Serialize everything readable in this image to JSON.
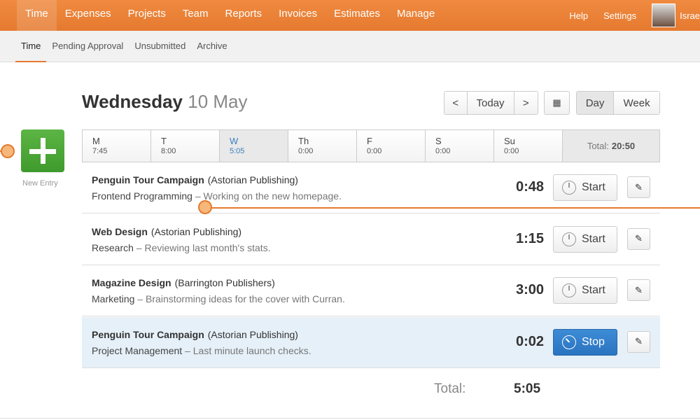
{
  "nav": {
    "items": [
      "Time",
      "Expenses",
      "Projects",
      "Team",
      "Reports",
      "Invoices",
      "Estimates",
      "Manage"
    ],
    "help": "Help",
    "settings": "Settings",
    "user": "Israe"
  },
  "subnav": [
    "Time",
    "Pending Approval",
    "Unsubmitted",
    "Archive"
  ],
  "header": {
    "weekday": "Wednesday",
    "date": "10 May"
  },
  "controls": {
    "prev": "<",
    "today": "Today",
    "next": ">",
    "calendar_icon": "calendar-icon",
    "day": "Day",
    "week": "Week"
  },
  "new_entry": "New Entry",
  "days": [
    {
      "d": "M",
      "t": "7:45"
    },
    {
      "d": "T",
      "t": "8:00"
    },
    {
      "d": "W",
      "t": "5:05"
    },
    {
      "d": "Th",
      "t": "0:00"
    },
    {
      "d": "F",
      "t": "0:00"
    },
    {
      "d": "S",
      "t": "0:00"
    },
    {
      "d": "Su",
      "t": "0:00"
    }
  ],
  "week_total_label": "Total:",
  "week_total": "20:50",
  "entries": [
    {
      "project": "Penguin Tour Campaign",
      "client": "(Astorian Publishing)",
      "task": "Frontend Programming",
      "note": "Working on the new homepage.",
      "duration": "0:48",
      "action": "Start"
    },
    {
      "project": "Web Design",
      "client": "(Astorian Publishing)",
      "task": "Research",
      "note": "Reviewing last month's stats.",
      "duration": "1:15",
      "action": "Start"
    },
    {
      "project": "Magazine Design",
      "client": "(Barrington Publishers)",
      "task": "Marketing",
      "note": "Brainstorming ideas for the cover with Curran.",
      "duration": "3:00",
      "action": "Start"
    },
    {
      "project": "Penguin Tour Campaign",
      "client": "(Astorian Publishing)",
      "task": "Project Management",
      "note": "Last minute launch checks.",
      "duration": "0:02",
      "action": "Stop"
    }
  ],
  "day_total_label": "Total:",
  "day_total": "5:05",
  "colors": {
    "brand": "#e8833a",
    "primary": "#2a74c0",
    "add": "#4aa636",
    "highlight": "#e6f0f8"
  }
}
